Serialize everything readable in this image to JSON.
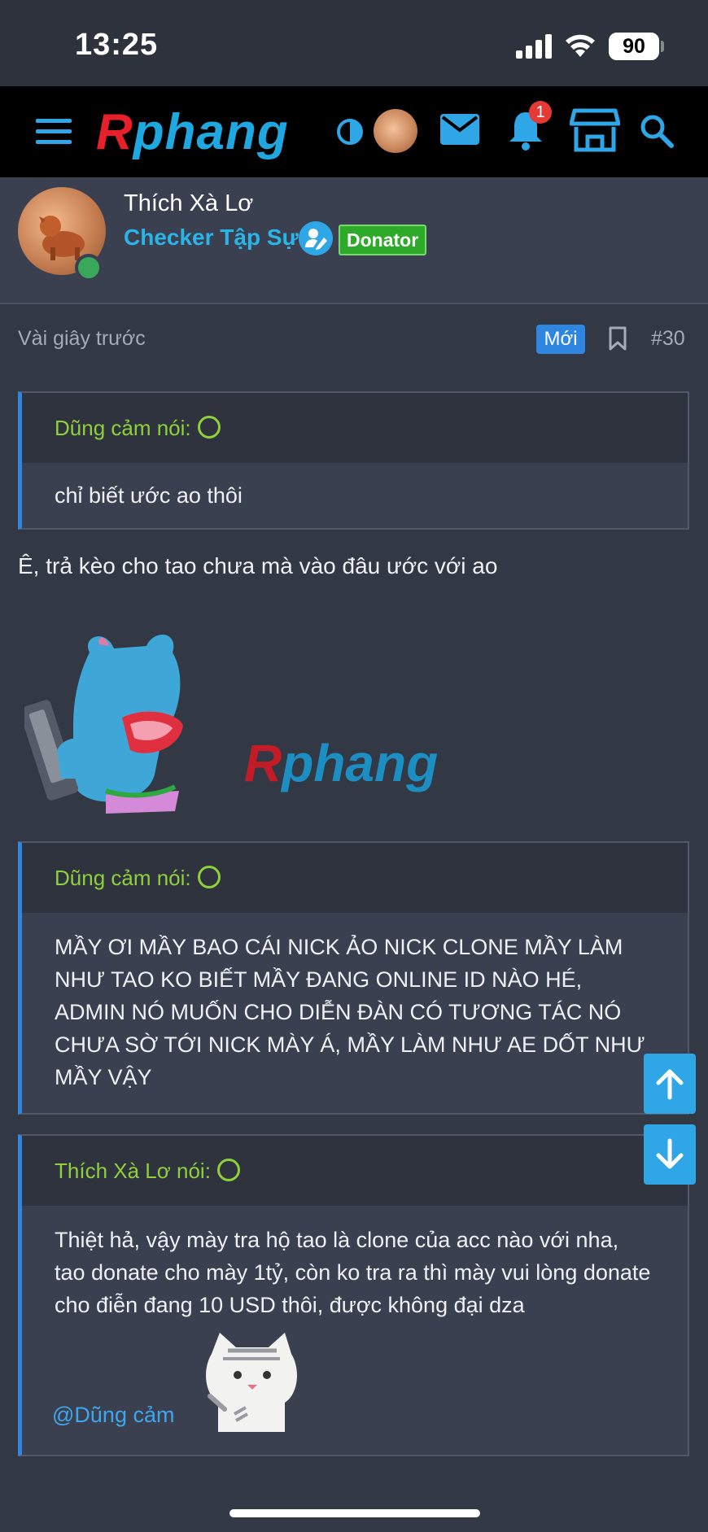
{
  "status_bar": {
    "time": "13:25",
    "battery": "90"
  },
  "nav": {
    "logo_first": "R",
    "logo_rest": "phang",
    "notification_count": "1"
  },
  "author": {
    "name": "Thích Xà Lơ",
    "rank": "Checker Tập Sự",
    "badge": "Donator"
  },
  "post": {
    "time": "Vài giây trước",
    "new_label": "Mới",
    "number": "#30",
    "quotes": [
      {
        "author": "Dũng cảm nói:",
        "text": "chỉ biết ước ao thôi"
      },
      {
        "author": "Dũng cảm nói:",
        "text": "MẦY ƠI MẦY BAO CÁI NICK ẢO NICK CLONE MẦY LÀM NHƯ TAO KO BIẾT MẦY ĐANG ONLINE ID NÀO HÉ, ADMIN NÓ MUỐN CHO DIỄN ĐÀN CÓ TƯƠNG TÁC NÓ CHƯA SỜ TỚI NICK MÀY Á, MẦY LÀM NHƯ AE DỐT NHƯ MẦY VẬY"
      },
      {
        "author": "Thích Xà Lơ nói:",
        "text": "Thiệt hả, vậy mày tra hộ tao là clone của acc nào với nha, tao donate cho mày 1tỷ, còn ko tra ra thì mày vui lòng donate cho điễn đang 10 USD thôi, được không đại dza",
        "mention": "@Dũng cảm"
      }
    ],
    "body": "Ê, trả kèo cho tao chưa mà vào đâu ước với ao",
    "sticker_watermark_first": "R",
    "sticker_watermark_rest": "phang"
  }
}
